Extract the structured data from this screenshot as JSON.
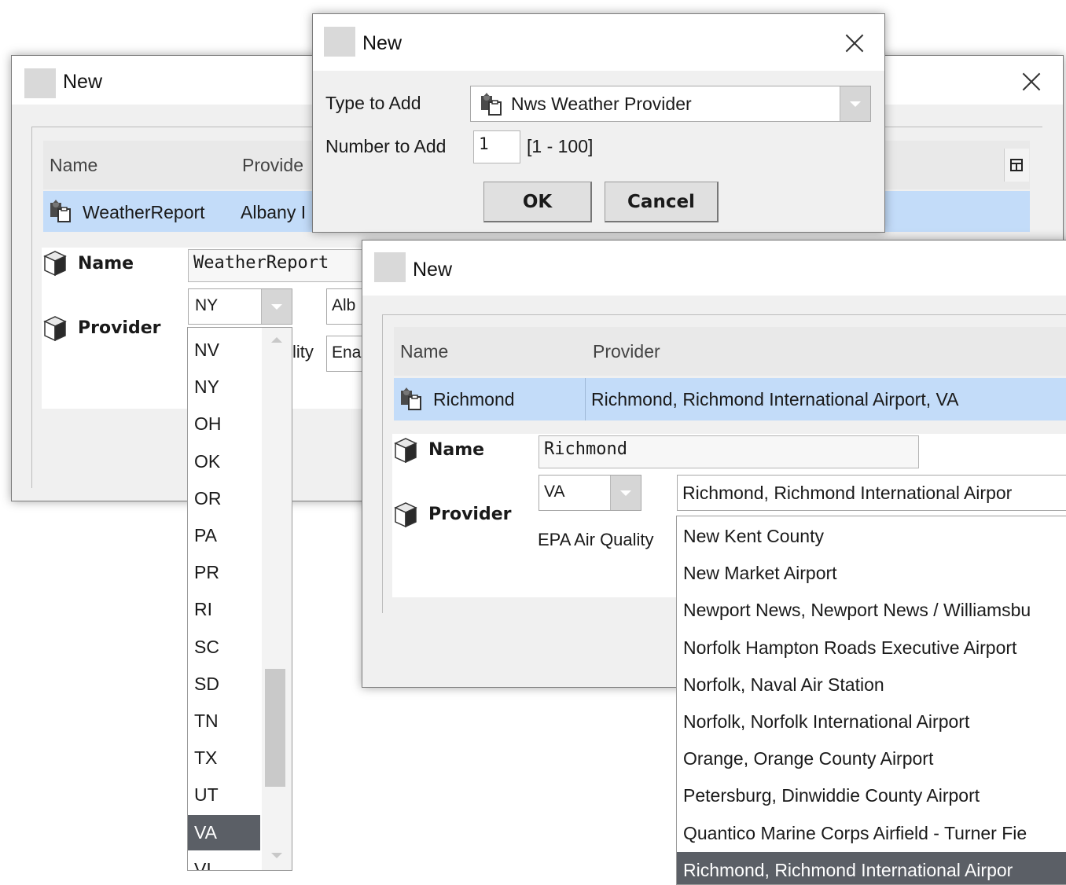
{
  "dialog_back": {
    "title": "New",
    "table": {
      "col_name": "Name",
      "col_provider": "Provide",
      "row": {
        "name": "WeatherReport",
        "provider": "Albany I"
      }
    },
    "name_label": "Name",
    "name_value": "WeatherReport",
    "provider_label": "Provider",
    "state_value": "NY",
    "station_value": "Alb",
    "air_quality_label": "lity",
    "air_quality_value": "Ena",
    "state_list": [
      "NV",
      "NY",
      "OH",
      "OK",
      "OR",
      "PA",
      "PR",
      "RI",
      "SC",
      "SD",
      "TN",
      "TX",
      "UT",
      "VA",
      "VI"
    ],
    "state_selected": "VA"
  },
  "dialog_add": {
    "title": "New",
    "type_label": "Type to Add",
    "type_value": "Nws Weather Provider",
    "number_label": "Number to Add",
    "number_value": "1",
    "number_range": "[1 - 100]",
    "ok_label": "OK",
    "cancel_label": "Cancel"
  },
  "dialog_front": {
    "title": "New",
    "table": {
      "col_name": "Name",
      "col_provider": "Provider",
      "row": {
        "name": "Richmond",
        "provider": "Richmond, Richmond International Airport, VA"
      }
    },
    "name_label": "Name",
    "name_value": "Richmond",
    "provider_label": "Provider",
    "state_value": "VA",
    "station_value": "Richmond, Richmond International Airpor",
    "air_quality_label": "EPA Air Quality",
    "station_list": [
      "New Kent County",
      "New Market Airport",
      "Newport News, Newport News / Williamsbu",
      "Norfolk Hampton Roads Executive Airport",
      "Norfolk, Naval Air Station",
      "Norfolk, Norfolk International Airport",
      "Orange, Orange County Airport",
      "Petersburg, Dinwiddie County Airport",
      "Quantico Marine Corps Airfield - Turner Fie",
      "Richmond, Richmond International Airpor"
    ],
    "station_selected": "Richmond, Richmond International Airpor"
  },
  "icons": {
    "title": "window-icon",
    "component": "weather-provider-icon",
    "property": "cube-icon",
    "table_options": "table-options-icon"
  },
  "colors": {
    "selection_row": "#c3dcf9",
    "list_selected": "#5b5f66"
  }
}
